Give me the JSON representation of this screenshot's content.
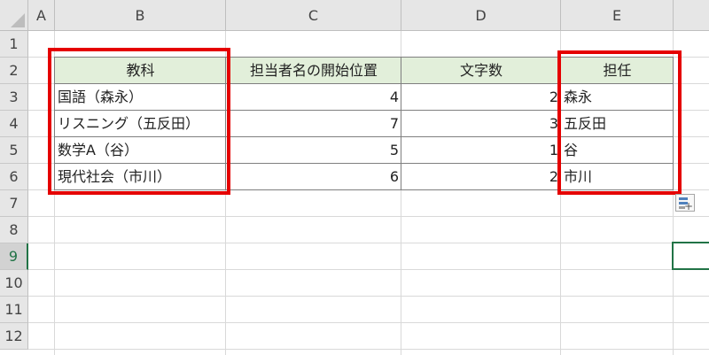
{
  "columns": [
    "A",
    "B",
    "C",
    "D",
    "E"
  ],
  "rows": [
    "1",
    "2",
    "3",
    "4",
    "5",
    "6",
    "7",
    "8",
    "9",
    "10",
    "11",
    "12"
  ],
  "table": {
    "headers": {
      "subject": "教科",
      "start_position": "担当者名の開始位置",
      "char_count": "文字数",
      "teacher": "担任"
    },
    "rows": [
      {
        "subject": "国語（森永）",
        "start_position": "4",
        "char_count": "2",
        "teacher": "森永"
      },
      {
        "subject": "リスニング（五反田）",
        "start_position": "7",
        "char_count": "3",
        "teacher": "五反田"
      },
      {
        "subject": "数学A（谷）",
        "start_position": "5",
        "char_count": "1",
        "teacher": "谷"
      },
      {
        "subject": "現代社会（市川）",
        "start_position": "6",
        "char_count": "2",
        "teacher": "市川"
      }
    ]
  },
  "active_row": "9",
  "colors": {
    "highlight": "#e50000",
    "header_fill": "#e2efda",
    "selection": "#217346"
  },
  "icons": [
    "flash-fill-options-icon"
  ]
}
